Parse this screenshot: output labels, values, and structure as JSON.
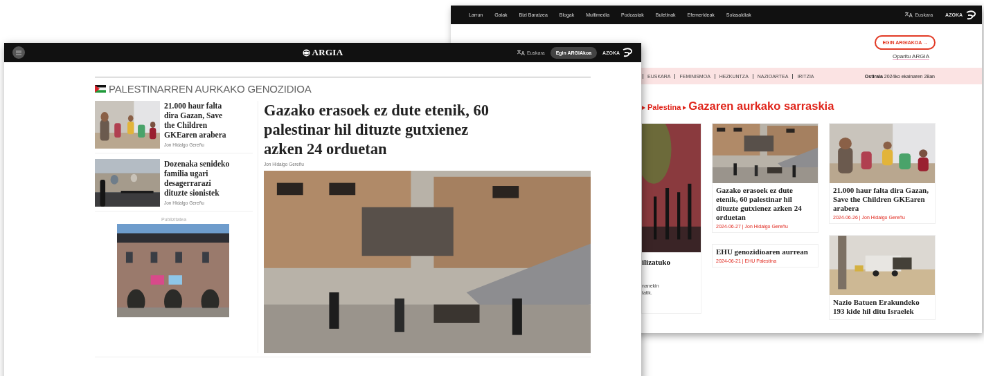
{
  "back_window": {
    "nav": [
      "Larrun",
      "Gaiak",
      "Bizi Baratzea",
      "Blogak",
      "Multimedia",
      "Podcastak",
      "Buletinak",
      "Efemerideak",
      "Solasaldiak"
    ],
    "language": "Euskara",
    "shop": "AZOKA",
    "join_button": "EGIN ARGIAKOA →",
    "gift_link": "Oparitu ARGIA",
    "topics": [
      "EUSKARA",
      "FEMINISMOA",
      "HEZKUNTZA",
      "NAZIOARTEA",
      "IRITZIA"
    ],
    "date": "**Ostirala** 2024ko ekainaren 28an",
    "breadcrumb": [
      "Palestina",
      "Gazaren aurkako sarraskia"
    ],
    "partial_card": {
      "title": "ilizatuko",
      "excerpt": [
        "nanekin",
        "tatik."
      ]
    },
    "columns": [
      [
        {
          "title": "Gazako erasoek ez dute etenik, 60 palestinar hil dituzte gutxienez azken 24 orduetan",
          "meta": "2024-06-27 | Jon Hidalgo Gereñu"
        },
        {
          "title": "EHU genozidioaren aurrean",
          "meta": "2024-06-21 | EHU Palestina"
        }
      ],
      [
        {
          "title": "21.000 haur falta dira Gazan, Save the Children GKEaren arabera",
          "meta": "2024-06-26 | Jon Hidalgo Gereñu"
        },
        {
          "title": "Nazio Batuen Erakundeko 193 kide hil ditu Israelek"
        }
      ]
    ]
  },
  "front_window": {
    "logo": "ARGIA",
    "language": "Euskara",
    "join_button": "Egin ARGIAkoa",
    "shop": "AZOKA",
    "section_title": "PALESTINARREN AURKAKO GENOZIDIOA",
    "side_articles": [
      {
        "title": "21.000 haur falta dira Gazan, Save the Children GKEaren arabera",
        "author": "Jon Hidalgo Gereñu"
      },
      {
        "title": "Dozenaka senideko familia ugari desagerrarazi dituzte sionistek",
        "author": "Jon Hidalgo Gereñu"
      }
    ],
    "ad_label": "Publizitatea",
    "main_article": {
      "title": "Gazako erasoek ez dute etenik, 60 palestinar hil dituzte gutxienez azken 24 orduetan",
      "author": "Jon Hidalgo Gereñu"
    }
  }
}
